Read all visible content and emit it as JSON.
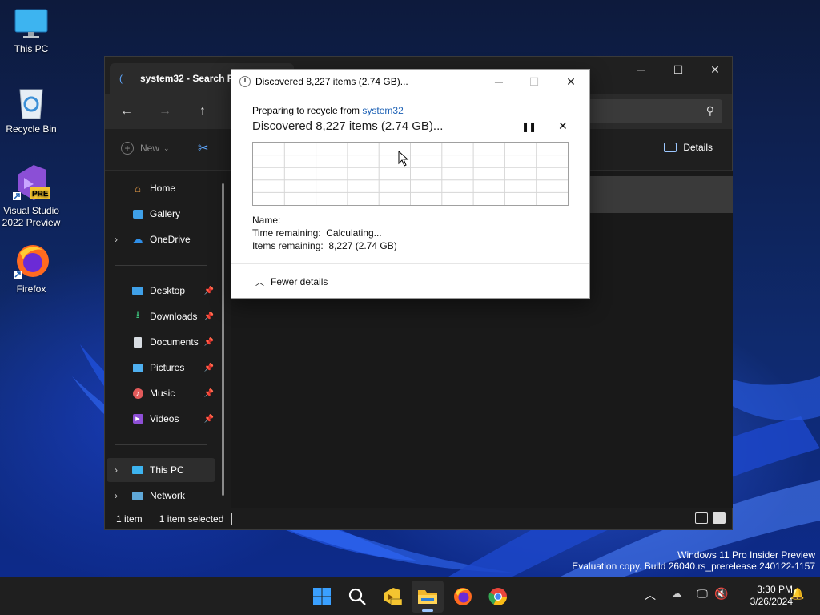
{
  "desktop": {
    "icons": [
      {
        "label": "This PC"
      },
      {
        "label": "Recycle Bin"
      },
      {
        "label": "Visual Studio 2022 Preview"
      },
      {
        "label": "Firefox"
      }
    ],
    "watermark_line1": "Windows 11 Pro Insider Preview",
    "watermark_line2": "Evaluation copy. Build 26040.rs_prerelease.240122-1157"
  },
  "explorer": {
    "tab_title": "system32 - Search Re",
    "toolbar": {
      "new_label": "New",
      "details_label": "Details"
    },
    "sidebar": {
      "home": "Home",
      "gallery": "Gallery",
      "onedrive": "OneDrive",
      "desktop": "Desktop",
      "downloads": "Downloads",
      "documents": "Documents",
      "pictures": "Pictures",
      "music": "Music",
      "videos": "Videos",
      "this_pc": "This PC",
      "network": "Network"
    },
    "status": {
      "items": "1 item",
      "selected": "1 item selected"
    }
  },
  "dialog": {
    "title": "Discovered 8,227 items (2.74 GB)...",
    "preparing_prefix": "Preparing to recycle from ",
    "preparing_location": "system32",
    "headline": "Discovered 8,227 items (2.74 GB)...",
    "name_label": "Name:",
    "time_label": "Time remaining:",
    "time_value": "Calculating...",
    "items_label": "Items remaining:",
    "items_value": "8,227 (2.74 GB)",
    "fewer_details": "Fewer details"
  },
  "taskbar": {
    "time": "3:30 PM",
    "date": "3/26/2024",
    "apps": [
      "start",
      "search",
      "visual-studio-preview",
      "file-explorer",
      "firefox",
      "chrome"
    ]
  },
  "colors": {
    "accent": "#1a5fb4",
    "explorer_bg": "#1c1c1c",
    "dialog_bg": "#ffffff"
  }
}
